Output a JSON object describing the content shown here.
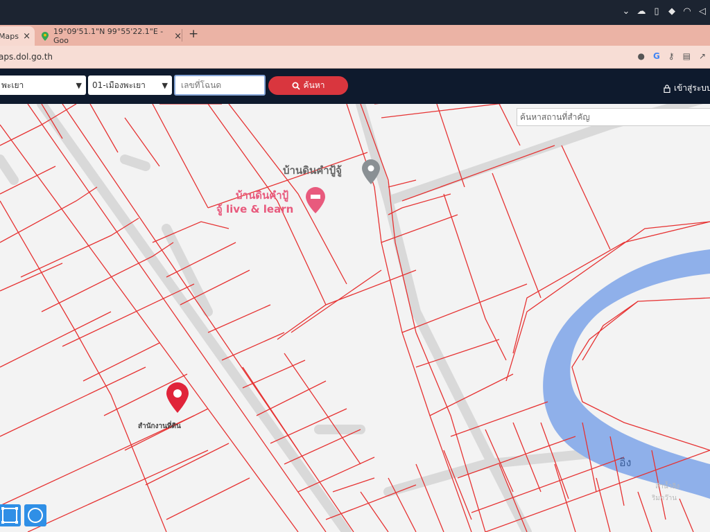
{
  "browser": {
    "tabs": [
      {
        "label": "Maps",
        "close": "×"
      },
      {
        "label": "19°09'51.1\"N 99°55'22.1\"E - Goo",
        "close": "×"
      }
    ],
    "new_tab": "+",
    "url": "aps.dol.go.th"
  },
  "toolbar": {
    "province_select": "พะเยา",
    "district_select": "01-เมืองพะเยา",
    "deed_placeholder": "เลขที่โฉนด",
    "search_button": "ค้นหา",
    "login": "เข้าสู่ระบบ"
  },
  "map": {
    "place_search_placeholder": "ค้นหาสถานที่สำคัญ",
    "poi_1": "บ้านดินคำปู้จู้",
    "poi_2_line1": "บ้านดินคำปู้",
    "poi_2_line2": "จู้ live & learn",
    "marker_label": "สำนักงานที่ดิน",
    "river_label": "อิง",
    "faded_label_1": "ลำน้ำอิง",
    "faded_label_2": "ริมกว๊าน",
    "colors": {
      "parcel_line": "#e63232",
      "river": "#8fb0ea",
      "navbar": "#0e1a2d",
      "search_button": "#d9363e",
      "marker": "#e0243a"
    }
  }
}
